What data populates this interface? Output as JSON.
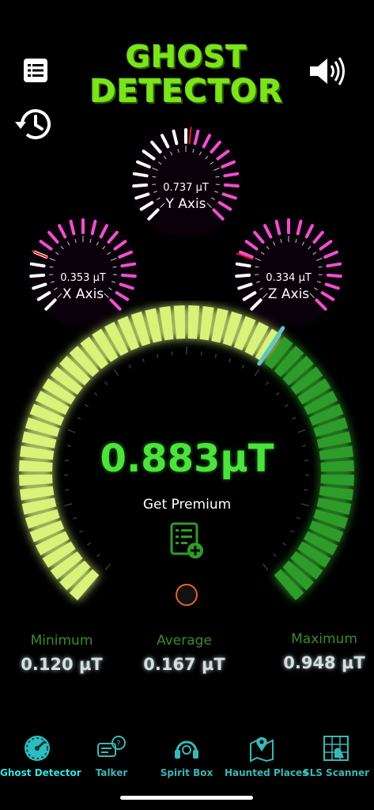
{
  "header": {
    "title_line1": "GHOST",
    "title_line2": "DETECTOR"
  },
  "axes": {
    "y": {
      "value": "0.737 µT",
      "label": "Y Axis",
      "level": 0.52
    },
    "x": {
      "value": "0.353 µT",
      "label": "X Axis",
      "level": 0.25
    },
    "z": {
      "value": "0.334 µT",
      "label": "Z Axis",
      "level": 0.24
    }
  },
  "main": {
    "reading": "0.883µT",
    "level": 0.62,
    "premium_label": "Get Premium"
  },
  "stats": {
    "min_label": "Minimum",
    "min_value": "0.120 µT",
    "avg_label": "Average",
    "avg_value": "0.167 µT",
    "max_label": "Maximum",
    "max_value": "0.948 µT"
  },
  "nav": {
    "items": [
      {
        "label": "Ghost Detector",
        "icon": "gauge-icon"
      },
      {
        "label": "Talker",
        "icon": "chat-question-icon"
      },
      {
        "label": "Spirit Box",
        "icon": "headset-icon"
      },
      {
        "label": "Haunted Places",
        "icon": "map-pin-icon"
      },
      {
        "label": "SLS Scanner",
        "icon": "grid-scan-icon"
      }
    ]
  },
  "colors": {
    "accent_green": "#4be33c",
    "gauge_light": "#d8f27a",
    "gauge_dark": "#2f9c2a",
    "tick_pink": "#ef4fcf",
    "needle": "#58c9c9",
    "nav_text": "#3bb7b7"
  }
}
